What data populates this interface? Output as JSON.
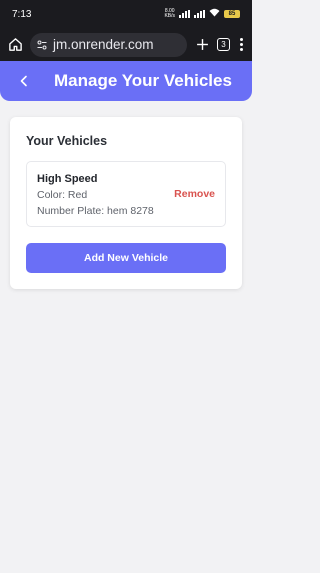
{
  "status_bar": {
    "time": "7:13",
    "net_speed_value": "8.00",
    "net_speed_unit": "KB/s",
    "battery_level": "85"
  },
  "browser": {
    "url": "jm.onrender.com",
    "tab_count": "3"
  },
  "header": {
    "title": "Manage Your Vehicles"
  },
  "vehicles_card": {
    "title": "Your Vehicles",
    "items": [
      {
        "name": "High Speed",
        "color_line": "Color: Red",
        "plate_line": "Number Plate: hem 8278",
        "remove_label": "Remove"
      }
    ],
    "add_label": "Add New Vehicle"
  },
  "colors": {
    "accent": "#6a6ff6",
    "remove": "#d9534f",
    "background": "#f2f2f4"
  }
}
